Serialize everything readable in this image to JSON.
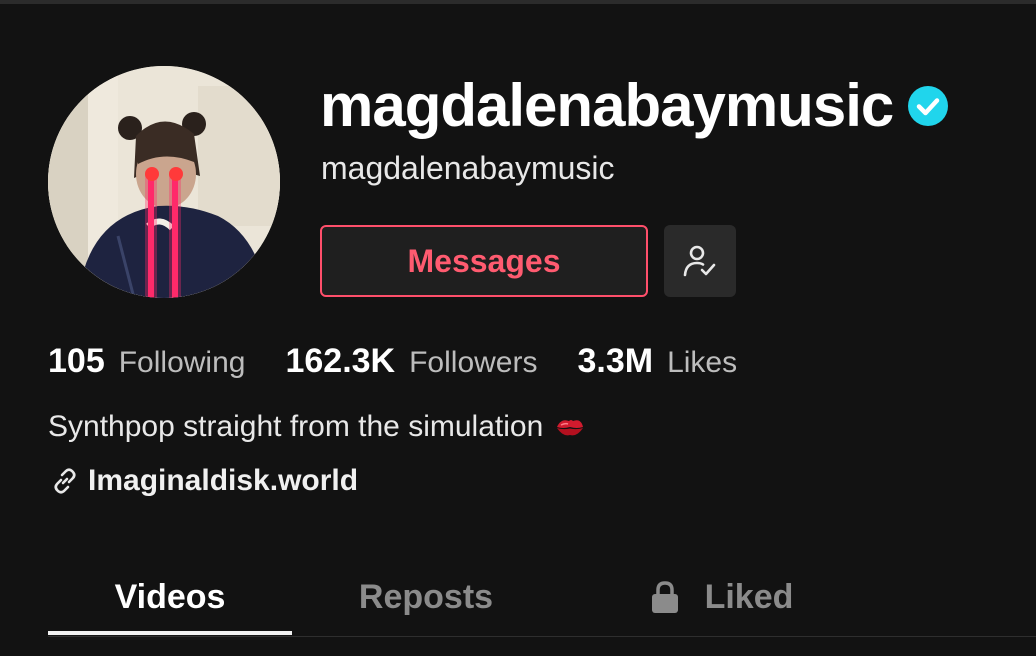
{
  "profile": {
    "username": "magdalenabaymusic",
    "nickname": "magdalenabaymusic",
    "verified": true,
    "bio": "Synthpop straight from the simulation",
    "bio_emoji": "kiss-mark-icon",
    "link": "Imaginaldisk.world"
  },
  "actions": {
    "messages_label": "Messages",
    "follow_state_icon": "user-check-icon"
  },
  "stats": {
    "following_count": "105",
    "following_label": "Following",
    "followers_count": "162.3K",
    "followers_label": "Followers",
    "likes_count": "3.3M",
    "likes_label": "Likes"
  },
  "tabs": [
    {
      "label": "Videos",
      "active": true
    },
    {
      "label": "Reposts",
      "active": false
    },
    {
      "label": "Liked",
      "active": false,
      "icon": "lock-icon"
    }
  ],
  "colors": {
    "background": "#121212",
    "accent": "#ff5b70",
    "verified": "#20d5ec"
  }
}
